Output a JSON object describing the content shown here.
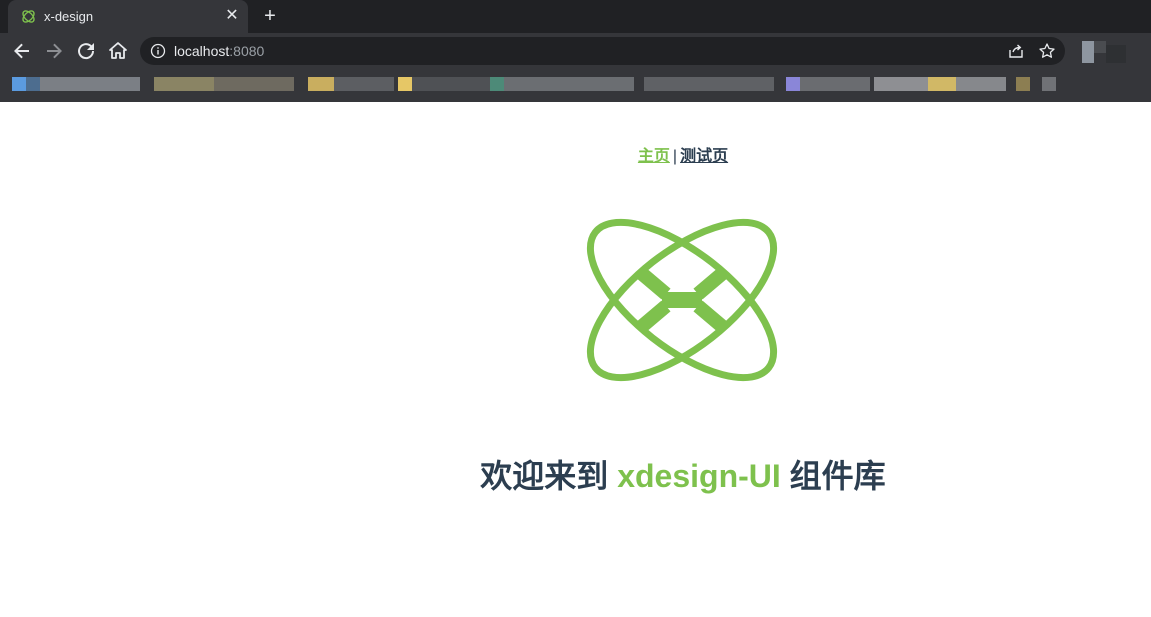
{
  "browser": {
    "tab": {
      "title": "x-design",
      "close_glyph": "✕"
    },
    "new_tab_glyph": "+",
    "address": {
      "host": "localhost",
      "port": ":8080"
    },
    "icons": [
      "back-icon",
      "forward-icon",
      "reload-icon",
      "home-icon",
      "info-icon",
      "share-icon",
      "star-icon"
    ]
  },
  "nav": {
    "home_label": "主页",
    "separator": "|",
    "test_label": "测试页"
  },
  "headline": {
    "prefix": "欢迎来到 ",
    "brand": "xdesign-UI",
    "suffix": " 组件库"
  },
  "colors": {
    "brand_green": "#7ec14d",
    "text_dark": "#2c3e50",
    "chrome_dark": "#202124",
    "chrome_toolbar": "#35363a"
  }
}
